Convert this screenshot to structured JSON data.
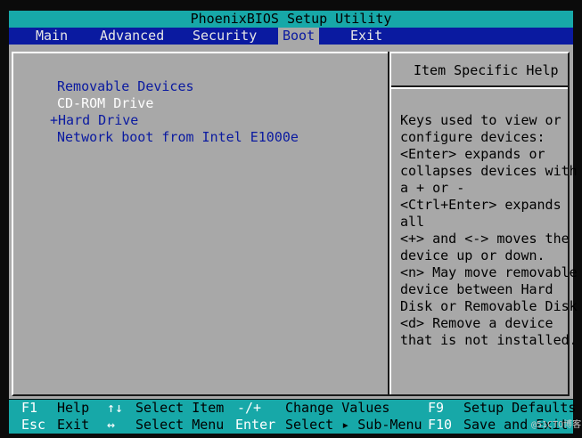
{
  "title": "PhoenixBIOS Setup Utility",
  "menu": [
    {
      "label": "Main"
    },
    {
      "label": "Advanced"
    },
    {
      "label": "Security"
    },
    {
      "label": "Boot",
      "active": true
    },
    {
      "label": "Exit"
    }
  ],
  "boot_items": [
    {
      "label": "Removable Devices",
      "selected": false
    },
    {
      "label": "CD-ROM Drive",
      "selected": true
    },
    {
      "label": "+Hard Drive",
      "selected": false
    },
    {
      "label": "Network boot from Intel E1000e",
      "selected": false
    }
  ],
  "help": {
    "title": "Item Specific Help",
    "lines": [
      "Keys used to view or",
      "configure devices:",
      "<Enter> expands or",
      "collapses devices with",
      "a + or -",
      "<Ctrl+Enter> expands",
      "all",
      "<+> and <-> moves the",
      "device up or down.",
      "<n> May move removable",
      "device between Hard",
      "Disk or Removable Disk",
      "<d> Remove a device",
      "that is not installed."
    ]
  },
  "footer": {
    "row1": [
      {
        "key": "F1",
        "desc": "Help"
      },
      {
        "key": "↑↓",
        "desc": "Select Item"
      },
      {
        "key": "-/+",
        "desc": "Change Values"
      },
      {
        "key": "F9",
        "desc": "Setup Defaults"
      }
    ],
    "row2": [
      {
        "key": "Esc",
        "desc": "Exit"
      },
      {
        "key": "↔",
        "desc": "Select Menu"
      },
      {
        "key": "Enter",
        "desc": "Select ▸ Sub-Menu"
      },
      {
        "key": "F10",
        "desc": "Save and Exit"
      }
    ]
  },
  "watermark": "@51CTO博客",
  "colors": {
    "title_bar": "#17a8a8",
    "menu_bar": "#0a1aa0",
    "panel": "#a8a8a8",
    "selected_item": "#ffffff",
    "item_text": "#0a1aa0"
  }
}
